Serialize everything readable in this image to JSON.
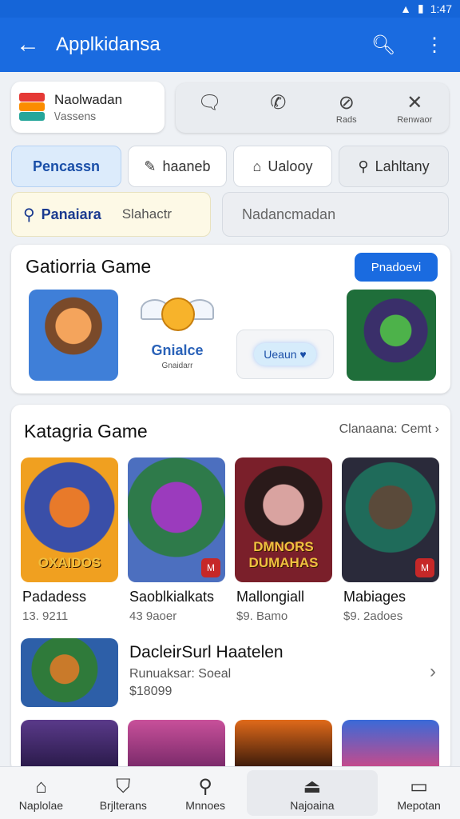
{
  "status_bar": {
    "time": "1:47"
  },
  "app_bar": {
    "title": "Applkidansa",
    "back_icon": "arrow-left-icon",
    "actions": [
      "search-icon",
      "menu-icon"
    ]
  },
  "app_info": {
    "name": "Naolwadan",
    "subtitle": "\\/assens"
  },
  "quick_actions": [
    {
      "icon": "chat-icon",
      "label": ""
    },
    {
      "icon": "phone-icon",
      "label": ""
    },
    {
      "icon": "tag-icon",
      "label": "Rads"
    },
    {
      "icon": "close-icon",
      "label": "Renwaor"
    }
  ],
  "chips": [
    {
      "label": "Pencassn",
      "icon": ""
    },
    {
      "label": "haaneb",
      "icon": "pencil-icon"
    },
    {
      "label": "Ualooy",
      "icon": "tag-icon"
    },
    {
      "label": "Lahltany",
      "icon": "wrench-icon"
    }
  ],
  "filter": {
    "label": "Panaiara",
    "value": "Slahactr"
  },
  "search": {
    "placeholder": "Nadancmadan"
  },
  "featured": {
    "title": "Gatiorria Game",
    "button_label": "Pnadoevi",
    "badge_title": "Gnialce",
    "badge_subtitle": "Gnaidarr",
    "upload_label": "Ueaun"
  },
  "category": {
    "title": "Katagria Game",
    "more_label": "Clanaana: Cemt",
    "tiles": [
      {
        "name": "Padadess",
        "meta": "13. 9211",
        "art_text": "OXAIDOS",
        "badge": ""
      },
      {
        "name": "Saoblkialkats",
        "meta": "43 9aoer",
        "art_text": "",
        "badge": "M"
      },
      {
        "name": "Mallongiall",
        "meta": "$9. Bamo",
        "art_text": "DMNORS DUMAHAS",
        "badge": ""
      },
      {
        "name": "Mabiages",
        "meta": "$9. 2adoes",
        "art_text": "",
        "badge": "M"
      }
    ],
    "featured_item": {
      "title": "DacleirSurl Haatelen",
      "subtitle": "Runuaksar: Soeal",
      "price": "$18099"
    }
  },
  "bottom_nav": [
    {
      "label": "Naplolae",
      "icon": "home-icon"
    },
    {
      "label": "Brjlterans",
      "icon": "shield-icon"
    },
    {
      "label": "Mnnoes",
      "icon": "search-icon"
    },
    {
      "label": "Najoaina",
      "icon": "bell-icon"
    },
    {
      "label": "Mepotan",
      "icon": "bookmark-icon"
    }
  ],
  "colors": {
    "primary": "#1a6be0",
    "chip_active": "#dcebfb",
    "filter_bg": "#fdf9e6"
  }
}
